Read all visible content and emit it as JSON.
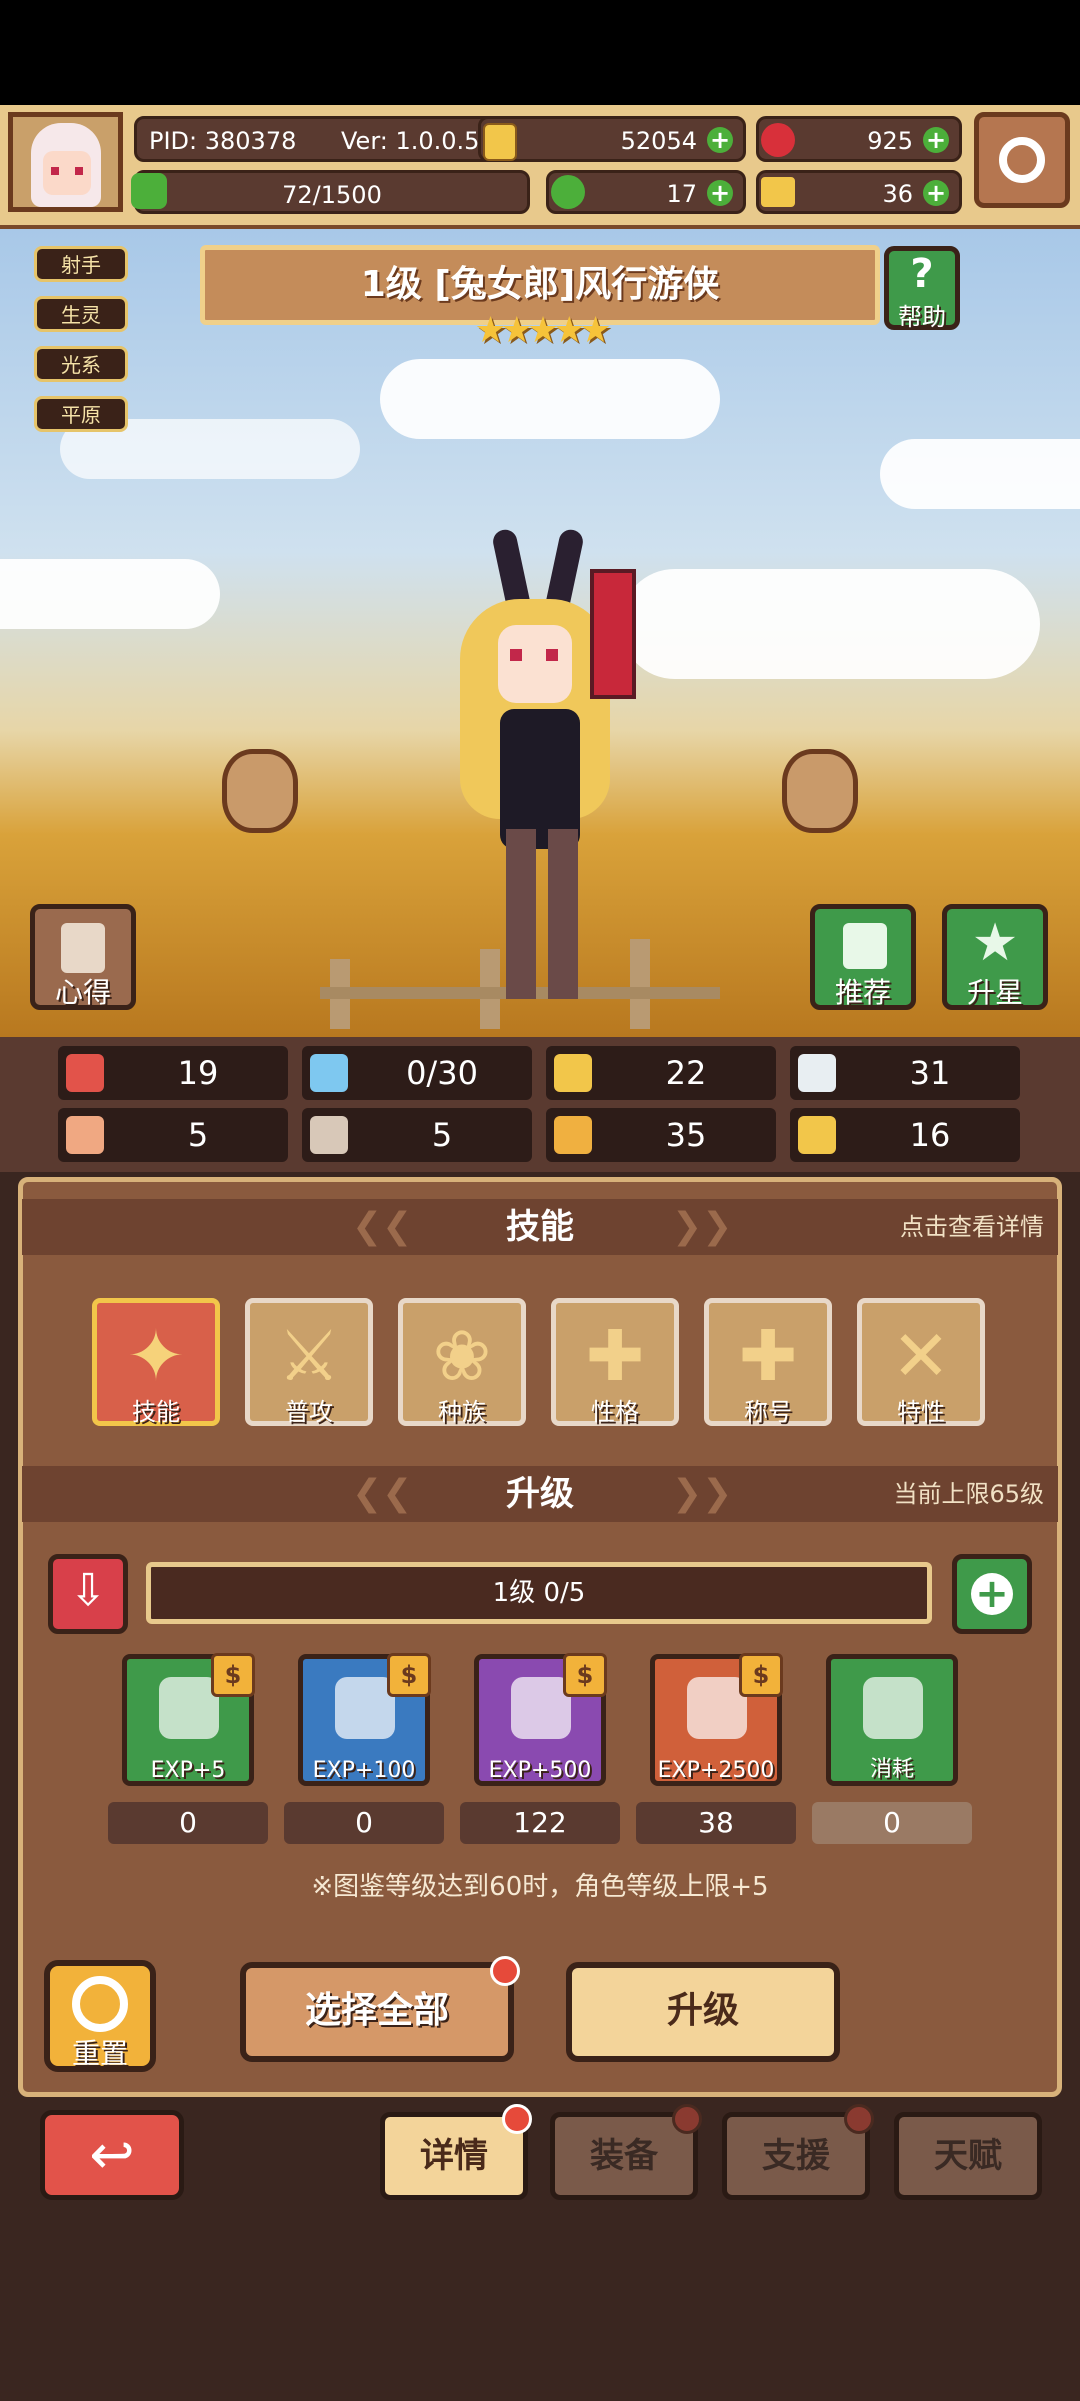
{
  "header": {
    "pid": "PID: 380378",
    "version": "Ver: 1.0.0.5",
    "gold": "52054",
    "gems": "925",
    "stamina": "72/1500",
    "clovers": "17",
    "tickets": "36"
  },
  "tags": [
    "射手",
    "生灵",
    "光系",
    "平原"
  ],
  "character": {
    "title": "1级  [兔女郎]风行游侠",
    "stars": "★★★★★",
    "help_label": "帮助"
  },
  "side_buttons": {
    "insight": "心得",
    "recommend": "推荐",
    "star_up": "升星"
  },
  "stats": [
    {
      "icon": "heart-icon",
      "value": "19",
      "color": "#e2534a"
    },
    {
      "icon": "mana-drop-icon",
      "value": "0/30",
      "color": "#7ec8f0"
    },
    {
      "icon": "shield-icon",
      "value": "22",
      "color": "#f2c64a"
    },
    {
      "icon": "wing-icon",
      "value": "31",
      "color": "#e8eef2"
    },
    {
      "icon": "fist-icon",
      "value": "5",
      "color": "#f0a882"
    },
    {
      "icon": "book-icon",
      "value": "5",
      "color": "#d8c8b8"
    },
    {
      "icon": "boot-icon",
      "value": "35",
      "color": "#f0b040"
    },
    {
      "icon": "magnet-icon",
      "value": "16",
      "color": "#f2c64a"
    }
  ],
  "skills_section": {
    "title": "技能",
    "hint": "点击查看详情",
    "items": [
      {
        "label": "技能",
        "icon": "skill-scroll-icon",
        "active": true
      },
      {
        "label": "普攻",
        "icon": "sword-icon",
        "active": false
      },
      {
        "label": "种族",
        "icon": "rabbit-icon",
        "active": false
      },
      {
        "label": "性格",
        "icon": "cross-icon",
        "active": false
      },
      {
        "label": "称号",
        "icon": "cross-icon",
        "active": false
      },
      {
        "label": "特性",
        "icon": "crossed-swords-icon",
        "active": false
      }
    ]
  },
  "upgrade_section": {
    "title": "升级",
    "cap_text": "当前上限65级",
    "progress_text": "1级  0/5",
    "progress_fraction": 0,
    "items": [
      {
        "label": "EXP+5",
        "icon": "crystal-icon",
        "count": "0",
        "color": "#3f9a4a"
      },
      {
        "label": "EXP+100",
        "icon": "potion-icon",
        "count": "0",
        "color": "#3a7ac0"
      },
      {
        "label": "EXP+500",
        "icon": "berry-icon",
        "count": "122",
        "color": "#8a4ab0"
      },
      {
        "label": "EXP+2500",
        "icon": "cabbage-icon",
        "count": "38",
        "color": "#d0603a"
      },
      {
        "label": "消耗",
        "icon": "coin-icon",
        "count": "0",
        "color": "#3f9a4a"
      }
    ],
    "note": "※图鉴等级达到60时，角色等级上限+5"
  },
  "actions": {
    "reset": "重置",
    "select_all": "选择全部",
    "upgrade": "升级"
  },
  "bottom_tabs": [
    "详情",
    "装备",
    "支援",
    "天赋"
  ]
}
